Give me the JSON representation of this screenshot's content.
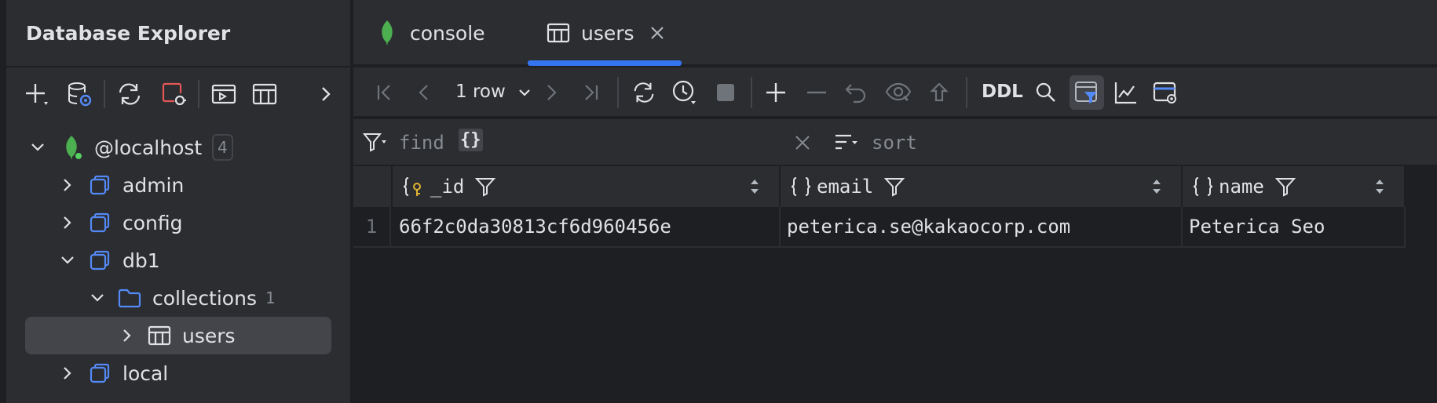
{
  "sidebar": {
    "title": "Database Explorer",
    "toolbar": [
      "add-icon",
      "datasource-properties-icon",
      "refresh-icon",
      "disconnect-icon",
      "query-console-icon",
      "table-icon",
      "expand-toolbar-icon"
    ],
    "tree": {
      "host": {
        "label": "@localhost",
        "count": "4"
      },
      "databases": [
        {
          "label": "admin"
        },
        {
          "label": "config"
        },
        {
          "label": "db1"
        },
        {
          "label": "local"
        }
      ],
      "collections": {
        "label": "collections",
        "count": "1"
      },
      "users": {
        "label": "users"
      }
    }
  },
  "tabs": [
    {
      "label": "console",
      "icon": "mongodb-leaf-icon"
    },
    {
      "label": "users",
      "icon": "table-icon",
      "active": true
    }
  ],
  "grid_toolbar": {
    "row_count": "1 row",
    "ddl_label": "DDL"
  },
  "filter": {
    "find_label": "find",
    "find_value": "{}",
    "sort_label": "sort"
  },
  "table": {
    "columns": [
      {
        "name": "_id",
        "icon": "key-braces-icon"
      },
      {
        "name": "email",
        "icon": "braces-icon"
      },
      {
        "name": "name",
        "icon": "braces-icon"
      }
    ],
    "rows": [
      {
        "num": "1",
        "cells": [
          "66f2c0da30813cf6d960456e",
          "peterica.se@kakaocorp.com",
          "Peterica Seo"
        ]
      }
    ]
  },
  "colors": {
    "accent": "#3574f0",
    "mongo_green": "#4caf50",
    "disconnect_red": "#e55757",
    "icon_blue": "#548af7"
  }
}
